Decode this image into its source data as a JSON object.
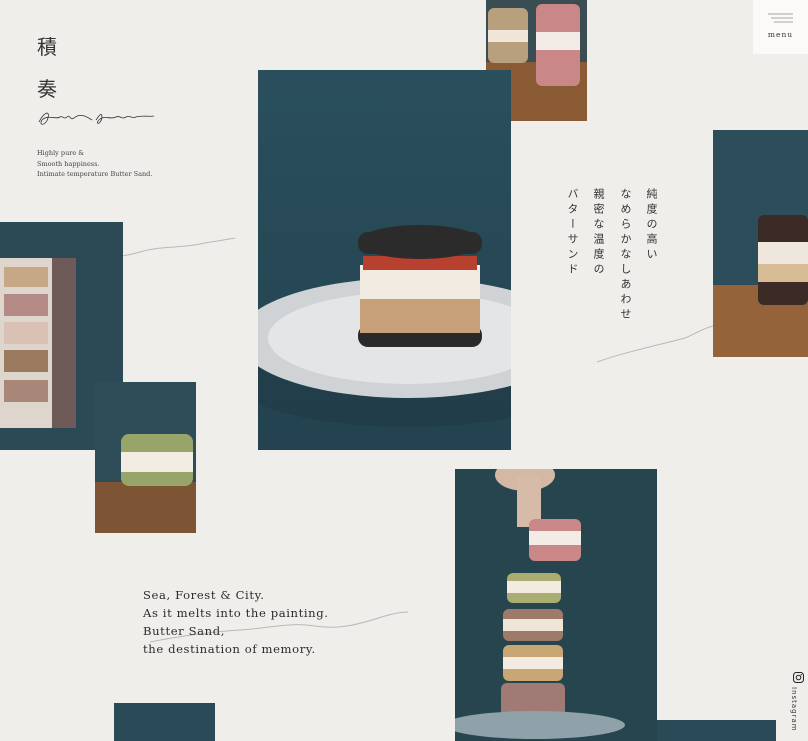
{
  "brand": {
    "title_line1": "積",
    "title_line2": "奏",
    "signature_alt": "Seki Sou"
  },
  "tagline": {
    "line1": "Highly pure &",
    "line2": "Smooth happiness.",
    "line3": "Intimate temperature Butter Sand."
  },
  "menu": {
    "label": "menu"
  },
  "vertical_copy": {
    "col1": "純度の高い",
    "col2": "なめらかなしあわせ",
    "col3": "親密な温度の",
    "col4": "バターサンド"
  },
  "message": {
    "line1": "Sea, Forest & City.",
    "line2": "As it melts into the painting.",
    "line3": "Butter Sand,",
    "line4": "the destination of memory."
  },
  "social": {
    "instagram_label": "Instagram"
  },
  "colors": {
    "background": "#f0eeeb",
    "teal": "#2b4f5e",
    "wood": "#8a5a34",
    "text": "#2b2b2b"
  },
  "icons": {
    "menu": "hamburger-icon",
    "instagram": "instagram-icon"
  }
}
